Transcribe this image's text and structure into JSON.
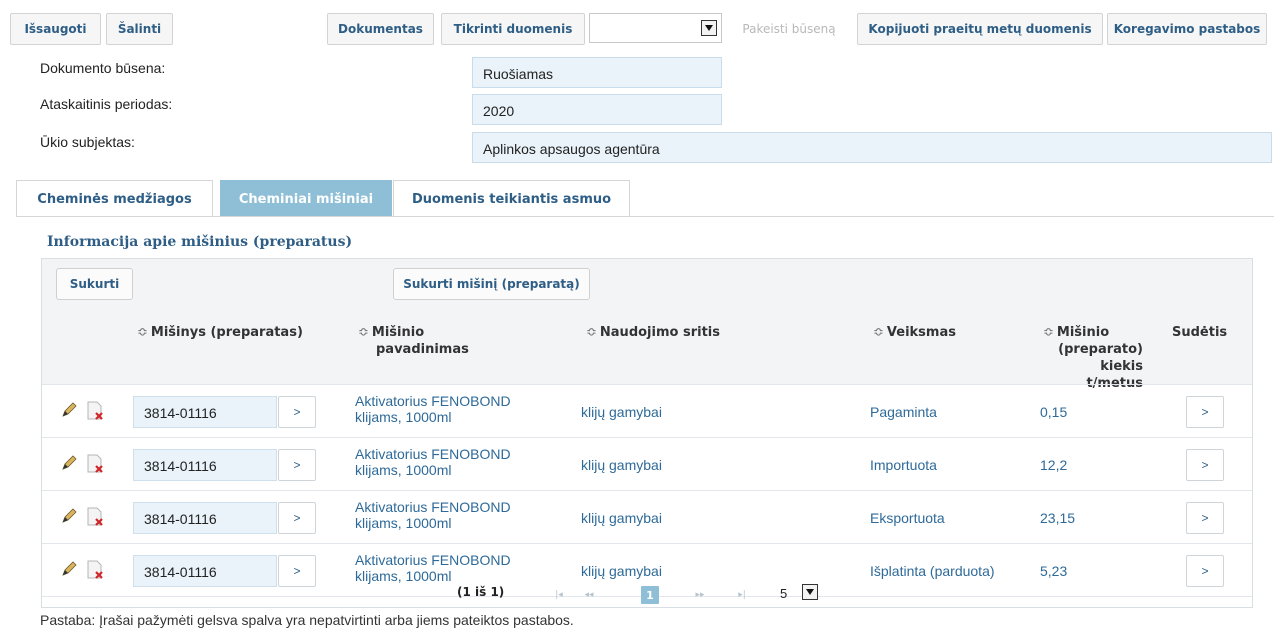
{
  "toolbar": {
    "save": "Išsaugoti",
    "delete": "Šalinti",
    "document": "Dokumentas",
    "check_data": "Tikrinti duomenis",
    "status_select_value": "",
    "change_status": "Pakeisti būseną",
    "copy_last_year": "Kopijuoti praeitų metų duomenis",
    "correction_notes": "Koregavimo pastabos"
  },
  "info": {
    "status_label": "Dokumento būsena:",
    "status_value": "Ruošiamas",
    "period_label": "Ataskaitinis periodas:",
    "period_value": "2020",
    "entity_label": "Ūkio subjektas:",
    "entity_value": "Aplinkos apsaugos agentūra"
  },
  "tabs": [
    {
      "label": "Cheminės medžiagos",
      "active": false
    },
    {
      "label": "Cheminiai mišiniai",
      "active": true
    },
    {
      "label": "Duomenis teikiantis asmuo",
      "active": false
    }
  ],
  "section_title": "Informacija apie mišinius (preparatus)",
  "grid": {
    "create": "Sukurti",
    "create_mixture": "Sukurti mišinį (preparatą)",
    "columns": {
      "mixture": "Mišinys (preparatas)",
      "name_l1": "Mišinio",
      "name_l2": "pavadinimas",
      "area": "Naudojimo sritis",
      "action": "Veiksmas",
      "qty_l1": "Mišinio",
      "qty_l2": "(preparato)",
      "qty_l3": "kiekis t/metus",
      "composition": "Sudėtis"
    },
    "rows": [
      {
        "code": "3814-01116",
        "name_l1": "Aktivatorius FENOBOND",
        "name_l2": "klijams, 1000ml",
        "area": "klijų gamybai",
        "action": "Pagaminta",
        "qty": "0,15"
      },
      {
        "code": "3814-01116",
        "name_l1": "Aktivatorius FENOBOND",
        "name_l2": "klijams, 1000ml",
        "area": "klijų gamybai",
        "action": "Importuota",
        "qty": "12,2"
      },
      {
        "code": "3814-01116",
        "name_l1": "Aktivatorius FENOBOND",
        "name_l2": "klijams, 1000ml",
        "area": "klijų gamybai",
        "action": "Eksportuota",
        "qty": "23,15"
      },
      {
        "code": "3814-01116",
        "name_l1": "Aktivatorius FENOBOND",
        "name_l2": "klijams, 1000ml",
        "area": "klijų gamybai",
        "action": "Išplatinta (parduota)",
        "qty": "5,23"
      }
    ],
    "go_label": ">",
    "sort_glyph": "≎"
  },
  "pager": {
    "summary": "(1 iš 1)",
    "first": "|◂",
    "prev": "◂◂",
    "current": "1",
    "next": "▸▸",
    "last": "▸|",
    "page_size": "5"
  },
  "note": "Pastaba: Įrašai pažymėti gelsva spalva yra nepatvirtinti arba jiems pateiktos pastabos.",
  "colors": {
    "accent": "#8ebfd6",
    "link": "#2e6a99",
    "field_bg": "#eaf3f9"
  }
}
